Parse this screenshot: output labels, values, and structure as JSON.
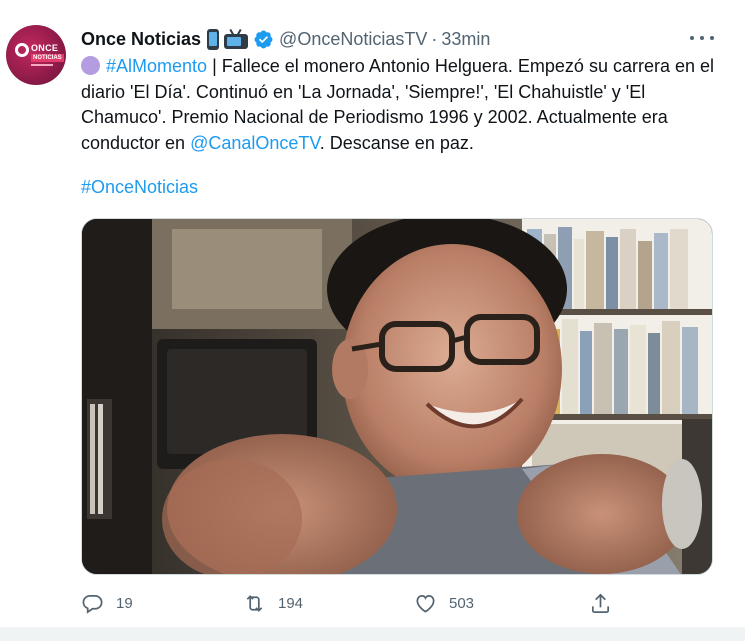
{
  "tweet": {
    "display_name": "Once Noticias",
    "name_emojis": [
      "mobile-phone-emoji",
      "television-emoji"
    ],
    "verified": true,
    "handle": "@OnceNoticiasTV",
    "separator": "·",
    "time": "33min",
    "avatar_text": {
      "top": "ONCE",
      "bottom": "NOTICIAS"
    },
    "body": {
      "emoji": "purple-circle-emoji",
      "hashtag_1": "#AlMomento",
      "text_1": " | Fallece el monero Antonio Helguera. Empezó su carrera en el diario 'El Día'. Continuó en 'La Jornada', 'Siempre!', 'El Chahuistle' y 'El Chamuco'. Premio Nacional de Periodismo 1996 y 2002. Actualmente era conductor en ",
      "mention": "@CanalOnceTV",
      "text_2": ". Descanse en paz."
    },
    "hashtag_2": "#OnceNoticias",
    "image_alt": "photo-of-smiling-man-with-glasses"
  },
  "actions": {
    "reply": {
      "icon": "reply-icon",
      "count": "19"
    },
    "retweet": {
      "icon": "retweet-icon",
      "count": "194"
    },
    "like": {
      "icon": "heart-icon",
      "count": "503"
    },
    "share": {
      "icon": "share-icon"
    }
  },
  "colors": {
    "link": "#1d9bf0",
    "secondary_text": "#536471",
    "verified": "#1d9bf0",
    "brand": "#8e1b4a"
  }
}
